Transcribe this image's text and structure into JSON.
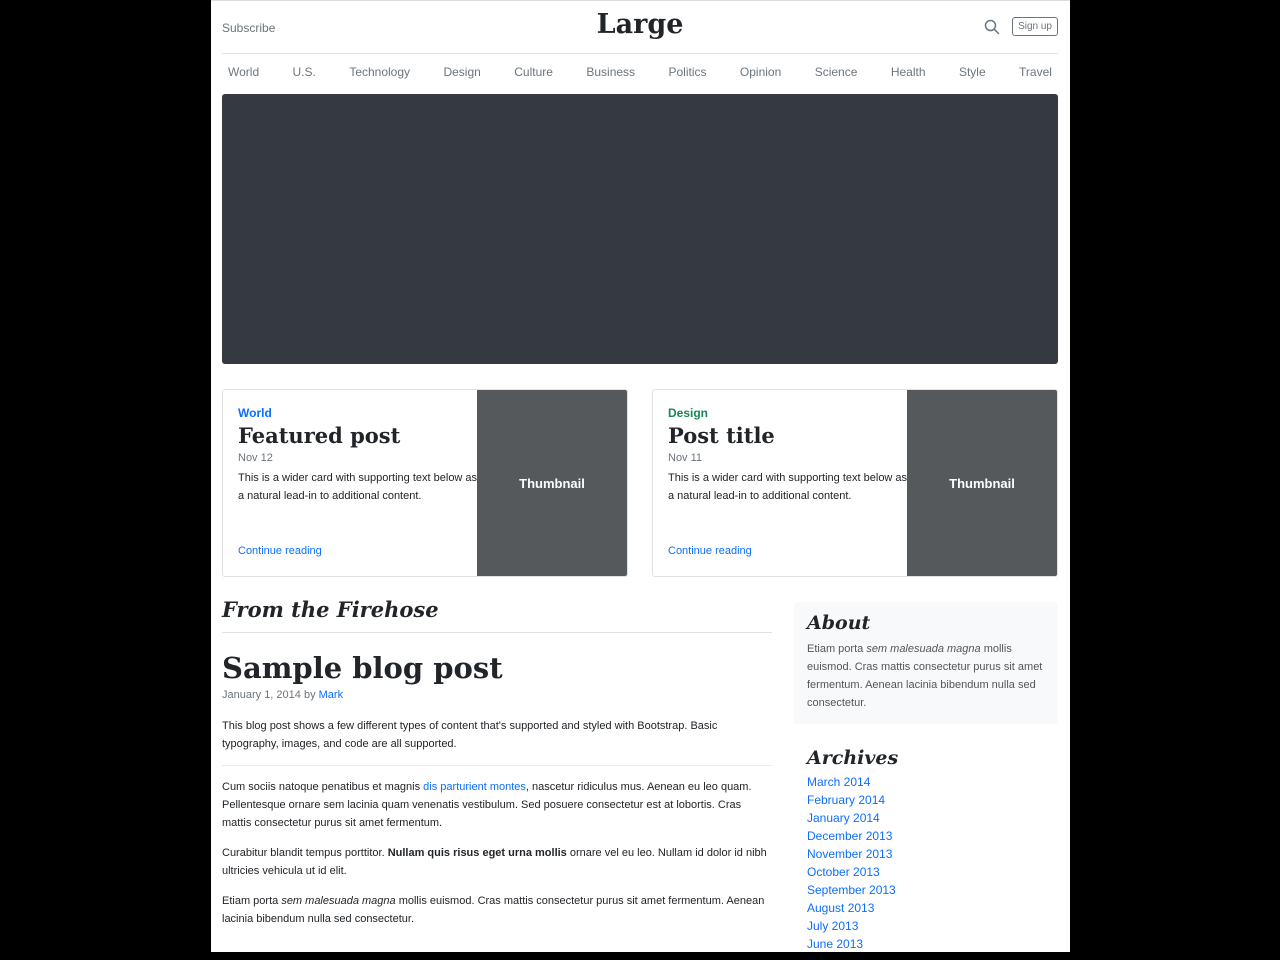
{
  "header": {
    "subscribe": "Subscribe",
    "brand": "Large",
    "signup": "Sign up"
  },
  "nav": [
    "World",
    "U.S.",
    "Technology",
    "Design",
    "Culture",
    "Business",
    "Politics",
    "Opinion",
    "Science",
    "Health",
    "Style",
    "Travel"
  ],
  "cards": [
    {
      "category": "World",
      "category_color": "#0d6efd",
      "title": "Featured post",
      "date": "Nov 12",
      "text": "This is a wider card with supporting text below as a natural lead-in to additional content.",
      "link": "Continue reading",
      "thumb": "Thumbnail"
    },
    {
      "category": "Design",
      "category_color": "#198754",
      "title": "Post title",
      "date": "Nov 11",
      "text": "This is a wider card with supporting text below as a natural lead-in to additional content.",
      "link": "Continue reading",
      "thumb": "Thumbnail"
    }
  ],
  "main": {
    "section_title": "From the Firehose",
    "post": {
      "title": "Sample blog post",
      "date": "January 1, 2014 by ",
      "author": "Mark",
      "intro": "This blog post shows a few different types of content that's supported and styled with Bootstrap. Basic typography, images, and code are all supported.",
      "p1_a": "Cum sociis natoque penatibus et magnis ",
      "p1_link": "dis parturient montes",
      "p1_b": ", nascetur ridiculus mus. Aenean eu leo quam. Pellentesque ornare sem lacinia quam venenatis vestibulum. Sed posuere consectetur est at lobortis. Cras mattis consectetur purus sit amet fermentum.",
      "p2_a": "Curabitur blandit tempus porttitor. ",
      "p2_bold": "Nullam quis risus eget urna mollis",
      "p2_b": " ornare vel eu leo. Nullam id dolor id nibh ultricies vehicula ut id elit.",
      "p3_a": "Etiam porta ",
      "p3_em": "sem malesuada magna",
      "p3_b": " mollis euismod. Cras mattis consectetur purus sit amet fermentum. Aenean lacinia bibendum nulla sed consectetur."
    }
  },
  "sidebar": {
    "about_title": "About",
    "about_a": "Etiam porta ",
    "about_em": "sem malesuada magna",
    "about_b": " mollis euismod. Cras mattis consectetur purus sit amet fermentum. Aenean lacinia bibendum nulla sed consectetur.",
    "archives_title": "Archives",
    "archives": [
      "March 2014",
      "February 2014",
      "January 2014",
      "December 2013",
      "November 2013",
      "October 2013",
      "September 2013",
      "August 2013",
      "July 2013",
      "June 2013"
    ]
  },
  "icons": {
    "search": "search-icon"
  }
}
